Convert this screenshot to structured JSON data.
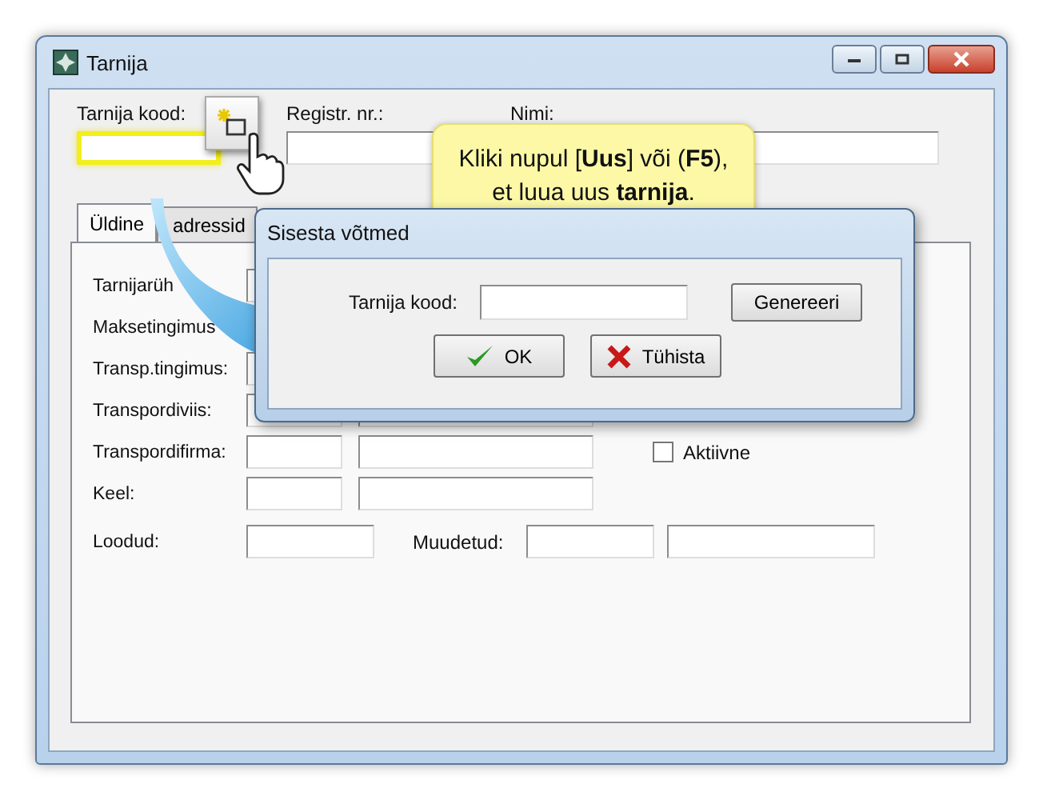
{
  "window": {
    "title": "Tarnija"
  },
  "header_fields": {
    "supplier_code": {
      "label": "Tarnija kood:",
      "highlighted": true
    },
    "reg_no": {
      "label": "Registr. nr.:"
    },
    "name": {
      "label": "Nimi:"
    }
  },
  "tabs": [
    {
      "label": "Üldine",
      "selected": true
    },
    {
      "label": "adressid",
      "selected": false
    }
  ],
  "form_rows": [
    {
      "label": "Tarnijarüh"
    },
    {
      "label": "Maksetingimus"
    },
    {
      "label": "Transp.tingimus:"
    },
    {
      "label": "Transpordiviis:"
    },
    {
      "label": "Transpordifirma:",
      "checkbox": {
        "label": "Aktiivne",
        "checked": false
      }
    },
    {
      "label": "Keel:"
    }
  ],
  "dates": {
    "created_label": "Loodud:",
    "modified_label": "Muudetud:"
  },
  "callout": {
    "text": "Kliki nupul [**Uus**] või (**F5**),\net luua uus **tarnija**."
  },
  "dialog": {
    "title": "Sisesta võtmed",
    "field_label": "Tarnija kood:",
    "generate_button": "Genereeri",
    "ok_button": "OK",
    "cancel_button": "Tühista"
  }
}
